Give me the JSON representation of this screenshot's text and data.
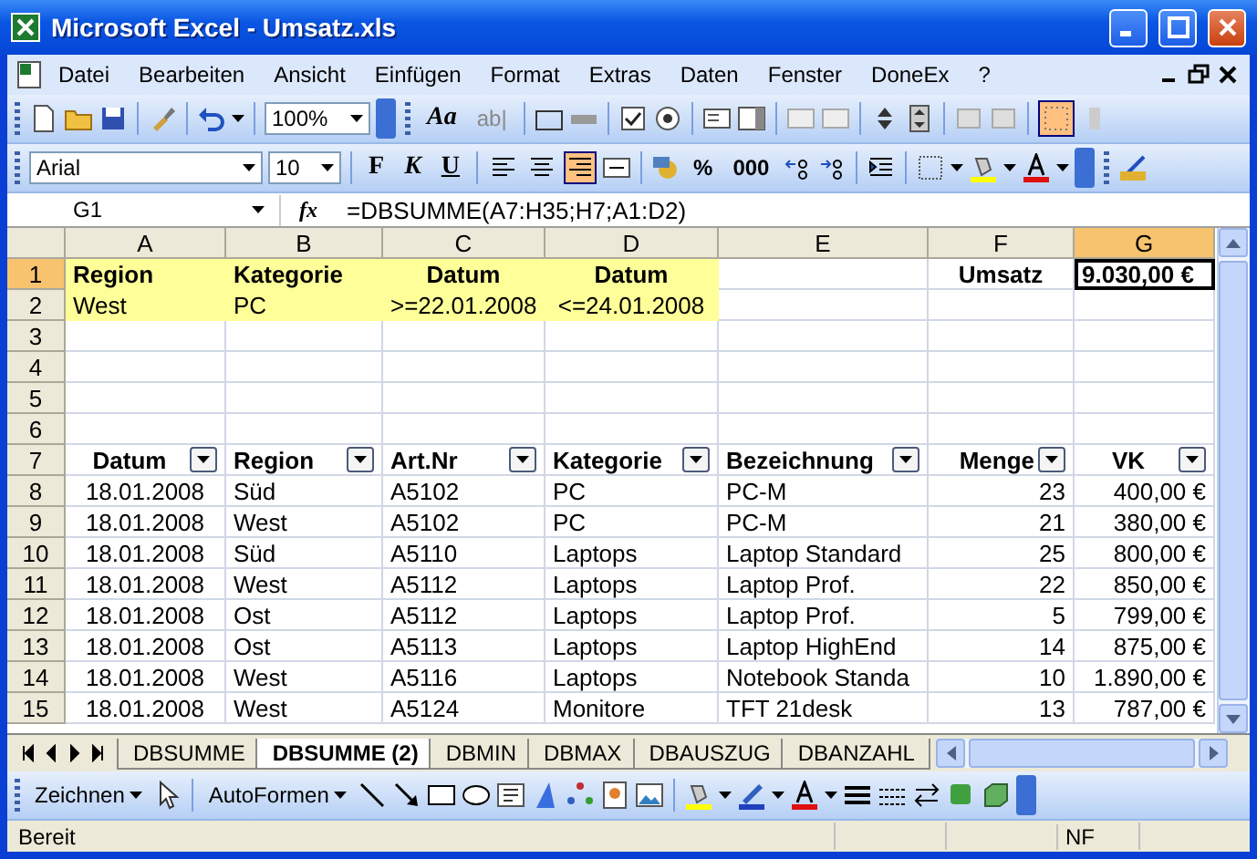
{
  "window": {
    "title": "Microsoft Excel - Umsatz.xls"
  },
  "menu": [
    "Datei",
    "Bearbeiten",
    "Ansicht",
    "Einfügen",
    "Format",
    "Extras",
    "Daten",
    "Fenster",
    "DoneEx",
    "?"
  ],
  "standard_toolbar": {
    "zoom": "100%",
    "texts": [
      "Aa",
      "ab|"
    ]
  },
  "format_toolbar": {
    "font": "Arial",
    "size": "10",
    "buttons": [
      {
        "label": "F",
        "kind": "bold",
        "selected": false
      },
      {
        "label": "K",
        "kind": "italic",
        "selected": false
      },
      {
        "label": "U",
        "kind": "underline",
        "selected": false
      }
    ],
    "align_buttons": [
      {
        "kind": "left",
        "selected": false
      },
      {
        "kind": "center",
        "selected": false
      },
      {
        "kind": "right",
        "selected": true
      }
    ],
    "texts": [
      "%",
      "000"
    ]
  },
  "formula_bar": {
    "name_box": "G1",
    "fx": "fx",
    "formula": "=DBSUMME(A7:H35;H7;A1:D2)"
  },
  "columns": [
    {
      "label": "A",
      "selected": false
    },
    {
      "label": "B",
      "selected": false
    },
    {
      "label": "C",
      "selected": false
    },
    {
      "label": "D",
      "selected": false
    },
    {
      "label": "E",
      "selected": false
    },
    {
      "label": "F",
      "selected": false
    },
    {
      "label": "G",
      "selected": true
    }
  ],
  "rows": [
    {
      "number": "1",
      "selected": true,
      "kind": "criteria_header",
      "cells": {
        "A": "Region",
        "B": "Kategorie",
        "C": "Datum",
        "D": "Datum",
        "F": "Umsatz",
        "G": "9.030,00 €"
      }
    },
    {
      "number": "2",
      "selected": false,
      "kind": "criteria",
      "cells": {
        "A": "West",
        "B": "PC",
        "C": ">=22.01.2008",
        "D": "<=24.01.2008"
      }
    },
    {
      "number": "3",
      "selected": false,
      "kind": "blank",
      "cells": {}
    },
    {
      "number": "4",
      "selected": false,
      "kind": "blank",
      "cells": {}
    },
    {
      "number": "5",
      "selected": false,
      "kind": "blank",
      "cells": {}
    },
    {
      "number": "6",
      "selected": false,
      "kind": "blank",
      "cells": {}
    },
    {
      "number": "7",
      "selected": false,
      "kind": "table_header",
      "cells": {
        "A": "Datum",
        "B": "Region",
        "C": "Art.Nr",
        "D": "Kategorie",
        "E": "Bezeichnung",
        "F": "Menge",
        "G": "VK"
      }
    },
    {
      "number": "8",
      "selected": false,
      "kind": "data",
      "cells": {
        "A": "18.01.2008",
        "B": "Süd",
        "C": "A5102",
        "D": "PC",
        "E": "PC-M",
        "F": "23",
        "G": "400,00 €"
      }
    },
    {
      "number": "9",
      "selected": false,
      "kind": "data",
      "cells": {
        "A": "18.01.2008",
        "B": "West",
        "C": "A5102",
        "D": "PC",
        "E": "PC-M",
        "F": "21",
        "G": "380,00 €"
      }
    },
    {
      "number": "10",
      "selected": false,
      "kind": "data",
      "cells": {
        "A": "18.01.2008",
        "B": "Süd",
        "C": "A5110",
        "D": "Laptops",
        "E": "Laptop Standard",
        "F": "25",
        "G": "800,00 €"
      }
    },
    {
      "number": "11",
      "selected": false,
      "kind": "data",
      "cells": {
        "A": "18.01.2008",
        "B": "West",
        "C": "A5112",
        "D": "Laptops",
        "E": "Laptop Prof.",
        "F": "22",
        "G": "850,00 €"
      }
    },
    {
      "number": "12",
      "selected": false,
      "kind": "data",
      "cells": {
        "A": "18.01.2008",
        "B": "Ost",
        "C": "A5112",
        "D": "Laptops",
        "E": "Laptop Prof.",
        "F": "5",
        "G": "799,00 €"
      }
    },
    {
      "number": "13",
      "selected": false,
      "kind": "data",
      "cells": {
        "A": "18.01.2008",
        "B": "Ost",
        "C": "A5113",
        "D": "Laptops",
        "E": "Laptop HighEnd",
        "F": "14",
        "G": "875,00 €"
      }
    },
    {
      "number": "14",
      "selected": false,
      "kind": "data",
      "cells": {
        "A": "18.01.2008",
        "B": "West",
        "C": "A5116",
        "D": "Laptops",
        "E": "Notebook Standa",
        "F": "10",
        "G": "1.890,00 €"
      }
    },
    {
      "number": "15",
      "selected": false,
      "kind": "data",
      "cells": {
        "A": "18.01.2008",
        "B": "West",
        "C": "A5124",
        "D": "Monitore",
        "E": "TFT 21desk",
        "F": "13",
        "G": "787,00 €"
      }
    }
  ],
  "sheet_tabs": [
    {
      "label": "DBSUMME",
      "selected": false
    },
    {
      "label": "DBSUMME (2)",
      "selected": true
    },
    {
      "label": "DBMIN",
      "selected": false
    },
    {
      "label": "DBMAX",
      "selected": false
    },
    {
      "label": "DBAUSZUG",
      "selected": false
    },
    {
      "label": "DBANZAHL",
      "selected": false
    }
  ],
  "drawing_toolbar": {
    "menus": [
      "Zeichnen",
      "AutoFormen"
    ]
  },
  "status_bar": {
    "status": "Bereit",
    "indicator": "NF"
  }
}
